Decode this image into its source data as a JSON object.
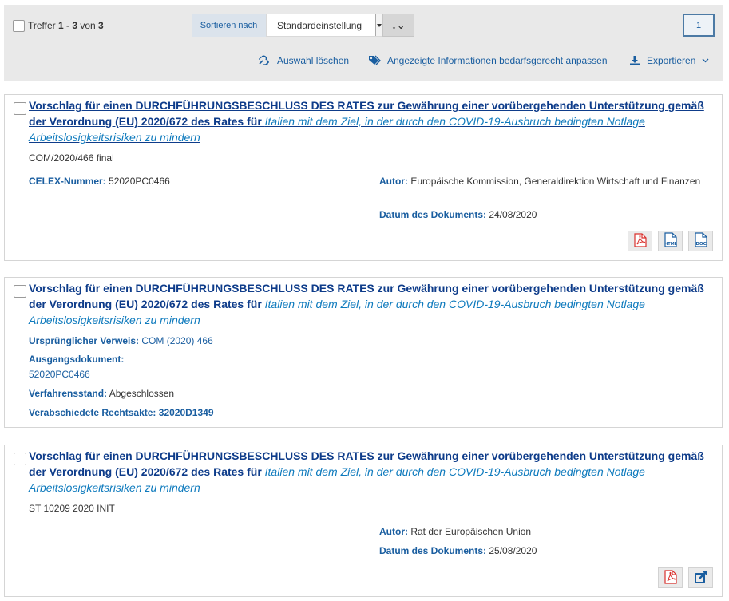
{
  "toolbar": {
    "hits_prefix": "Treffer ",
    "hits_range": "1 - 3",
    "hits_of": " von ",
    "hits_total": "3",
    "sort_label": "Sortieren nach",
    "sort_value": "Standardeinstellung",
    "sort_direction": "↓⌄",
    "page_number": "1",
    "clear_selection": "Auswahl löschen",
    "customize_info": "Angezeigte Informationen bedarfsgerecht anpassen",
    "export": "Exportieren"
  },
  "results": [
    {
      "title_bold": "Vorschlag für einen DURCHFÜHRUNGSBESCHLUSS DES RATES zur Gewährung einer vorübergehenden Unterstützung gemäß der Verordnung (EU) 2020/672 des Rates für ",
      "title_italic": "Italien mit dem Ziel, in der durch den COVID-19-Ausbruch bedingten Notlage Arbeitslosigkeitsrisiken zu mindern",
      "reference": "COM/2020/466 final",
      "celex_label": "CELEX-Nummer:",
      "celex_value": "52020PC0466",
      "author_label": "Autor:",
      "author_value": "Europäische Kommission, Generaldirektion Wirtschaft und Finanzen",
      "date_label": "Datum des Dokuments:",
      "date_value": "24/08/2020",
      "formats": [
        "pdf-icon",
        "html-icon",
        "doc-icon"
      ]
    },
    {
      "title_bold": "Vorschlag für einen DURCHFÜHRUNGSBESCHLUSS DES RATES zur Gewährung einer vorübergehenden Unterstützung gemäß der Verordnung (EU) 2020/672 des Rates für ",
      "title_italic": "Italien mit dem Ziel, in der durch den COVID-19-Ausbruch bedingten Notlage Arbeitslosigkeitsrisiken zu mindern",
      "orig_ref_label": "Ursprünglicher Verweis:",
      "orig_ref_value": "COM (2020) 466",
      "source_label": "Ausgangsdokument:",
      "source_value": "52020PC0466",
      "procedure_label": "Verfahrensstand:",
      "procedure_value": "Abgeschlossen",
      "adopted_label": "Verabschiedete Rechtsakte:",
      "adopted_value": "32020D1349"
    },
    {
      "title_bold": "Vorschlag für einen DURCHFÜHRUNGSBESCHLUSS DES RATES zur Gewährung einer vorübergehenden Unterstützung gemäß der Verordnung (EU) 2020/672 des Rates für ",
      "title_italic": "Italien mit dem Ziel, in der durch den COVID-19-Ausbruch bedingten Notlage Arbeitslosigkeitsrisiken zu mindern",
      "reference": "ST 10209 2020 INIT",
      "author_label": "Autor:",
      "author_value": "Rat der Europäischen Union",
      "date_label": "Datum des Dokuments:",
      "date_value": "25/08/2020",
      "formats": [
        "pdf-icon",
        "external-link-icon"
      ]
    }
  ],
  "colors": {
    "link_blue": "#1a5ea0",
    "title_blue": "#0e3c8a",
    "italic_blue": "#0e7abd",
    "pdf_red": "#d9302c",
    "toolbar_bg": "#e9e9e9"
  }
}
